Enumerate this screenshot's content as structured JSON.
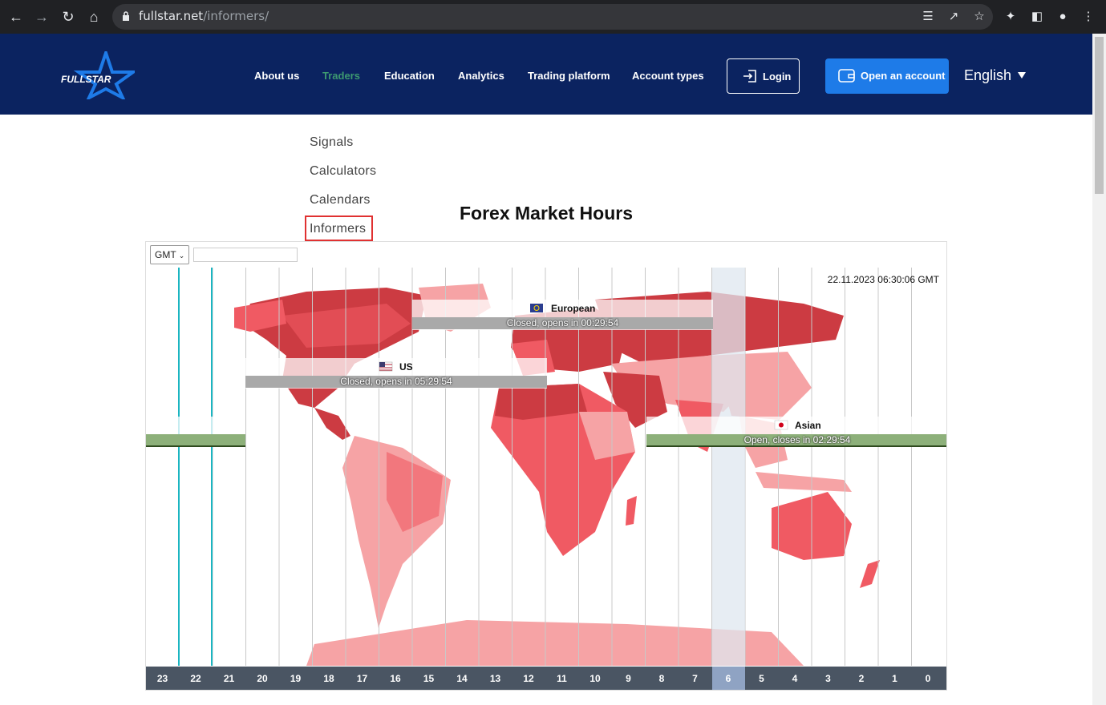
{
  "browser": {
    "url_host": "fullstar.net",
    "url_path": "/informers/"
  },
  "site": {
    "logo_text": "FULLSTAR",
    "menu": [
      {
        "label": "About us",
        "active": false
      },
      {
        "label": "Traders",
        "active": true
      },
      {
        "label": "Education",
        "active": false
      },
      {
        "label": "Analytics",
        "active": false
      },
      {
        "label": "Trading platform",
        "active": false
      },
      {
        "label": "Account types",
        "active": false
      }
    ],
    "login_label": "Login",
    "open_account_label": "Open an account",
    "language": "English"
  },
  "submenu": {
    "items": [
      "Signals",
      "Calculators",
      "Calendars",
      "Informers"
    ],
    "selected": "Informers"
  },
  "page": {
    "title": "Forex Market Hours"
  },
  "widget": {
    "timezone": "GMT",
    "datetime": "22.11.2023 06:30:06 GMT",
    "hours": [
      "23",
      "22",
      "21",
      "20",
      "19",
      "18",
      "17",
      "16",
      "15",
      "14",
      "13",
      "12",
      "11",
      "10",
      "9",
      "8",
      "7",
      "6",
      "5",
      "4",
      "3",
      "2",
      "1",
      "0"
    ],
    "current_hour": "6",
    "sessions": [
      {
        "name": "European",
        "status": "Closed, opens in 00:29:54",
        "open": false
      },
      {
        "name": "US",
        "status": "Closed, opens in 05:29:54",
        "open": false
      },
      {
        "name": "Asian",
        "status": "Open, closes in 02:29:54",
        "open": true
      }
    ],
    "colors": {
      "closed_bar": "#a9a9a9",
      "open_bar": "#8db07a",
      "map_dark": "#cc3b42",
      "map_mid": "#f05a63",
      "map_light": "#f6a3a5"
    }
  }
}
